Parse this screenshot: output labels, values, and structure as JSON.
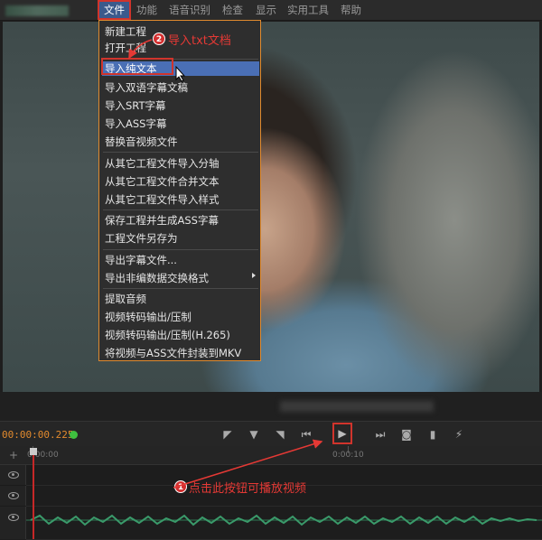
{
  "menubar": {
    "items": [
      "文件",
      "功能",
      "语音识别",
      "检查",
      "显示",
      "实用工具",
      "帮助"
    ]
  },
  "file_menu": {
    "items": [
      "新建工程",
      "打开工程",
      "导入纯文本",
      "导入双语字幕文稿",
      "导入SRT字幕",
      "导入ASS字幕",
      "替换音视频文件",
      "从其它工程文件导入分轴",
      "从其它工程文件合并文本",
      "从其它工程文件导入样式",
      "保存工程并生成ASS字幕",
      "工程文件另存为",
      "导出字幕文件...",
      "导出非编数据交换格式",
      "提取音频",
      "视频转码输出/压制",
      "视频转码输出/压制(H.265)",
      "将视频与ASS文件封装到MKV"
    ],
    "highlighted": "导入纯文本"
  },
  "annotations": {
    "step1": {
      "number": "1",
      "text": "点击此按钮可播放视频"
    },
    "step2": {
      "number": "2",
      "text": "导入txt文档"
    }
  },
  "player": {
    "timecode": "00:00:00.225",
    "status_color": "#3fbf3f"
  },
  "timeline": {
    "ruler_labels": [
      "0:00:00",
      "0:00:10"
    ]
  },
  "icons": [
    "set-in-icon",
    "marker-down-icon",
    "set-out-icon",
    "prev-frame-icon",
    "play-icon",
    "next-frame-icon",
    "camera-icon",
    "bookmark-icon",
    "magic-wand-icon",
    "eye-icon",
    "add-track-icon"
  ],
  "colors": {
    "accent": "#d0342c",
    "timecode": "#e28a2e",
    "menu_highlight": "#4a6fb5"
  }
}
